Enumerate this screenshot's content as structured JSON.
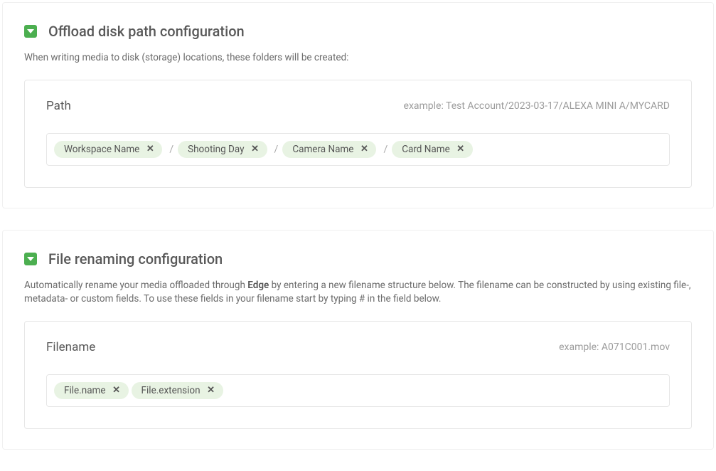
{
  "offload": {
    "title": "Offload disk path configuration",
    "description": "When writing media to disk (storage) locations, these folders will be created:",
    "box": {
      "label": "Path",
      "example": "example: Test Account/2023-03-17/ALEXA MINI A/MYCARD",
      "tokens": [
        "Workspace Name",
        "Shooting Day",
        "Camera Name",
        "Card Name"
      ],
      "separator": "/"
    }
  },
  "renaming": {
    "title": "File renaming configuration",
    "description_pre": "Automatically rename your media offloaded through ",
    "description_strong": "Edge",
    "description_post": " by entering a new filename structure below. The filename can be constructed by using existing file-, metadata- or custom fields. To use these fields in your filename start by typing # in the field below.",
    "box": {
      "label": "Filename",
      "example": "example: A071C001.mov",
      "tokens": [
        "File.name",
        "File.extension"
      ]
    }
  }
}
